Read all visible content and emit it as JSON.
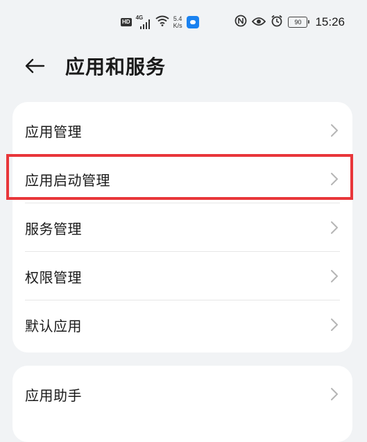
{
  "status_bar": {
    "hd": "HD",
    "network": "4G",
    "speed_value": "5.4",
    "speed_unit": "K/s",
    "battery": "90",
    "time": "15:26"
  },
  "header": {
    "title": "应用和服务"
  },
  "groups": [
    {
      "items": [
        {
          "label": "应用管理"
        },
        {
          "label": "应用启动管理"
        },
        {
          "label": "服务管理"
        },
        {
          "label": "权限管理"
        },
        {
          "label": "默认应用"
        }
      ]
    },
    {
      "items": [
        {
          "label": "应用助手"
        }
      ]
    }
  ],
  "highlight": {
    "target": "应用启动管理",
    "color": "#e8363a"
  },
  "colors": {
    "background": "#f1f3f5",
    "card": "#ffffff",
    "text": "#1a1a1a",
    "chevron": "#b5b5b5"
  }
}
